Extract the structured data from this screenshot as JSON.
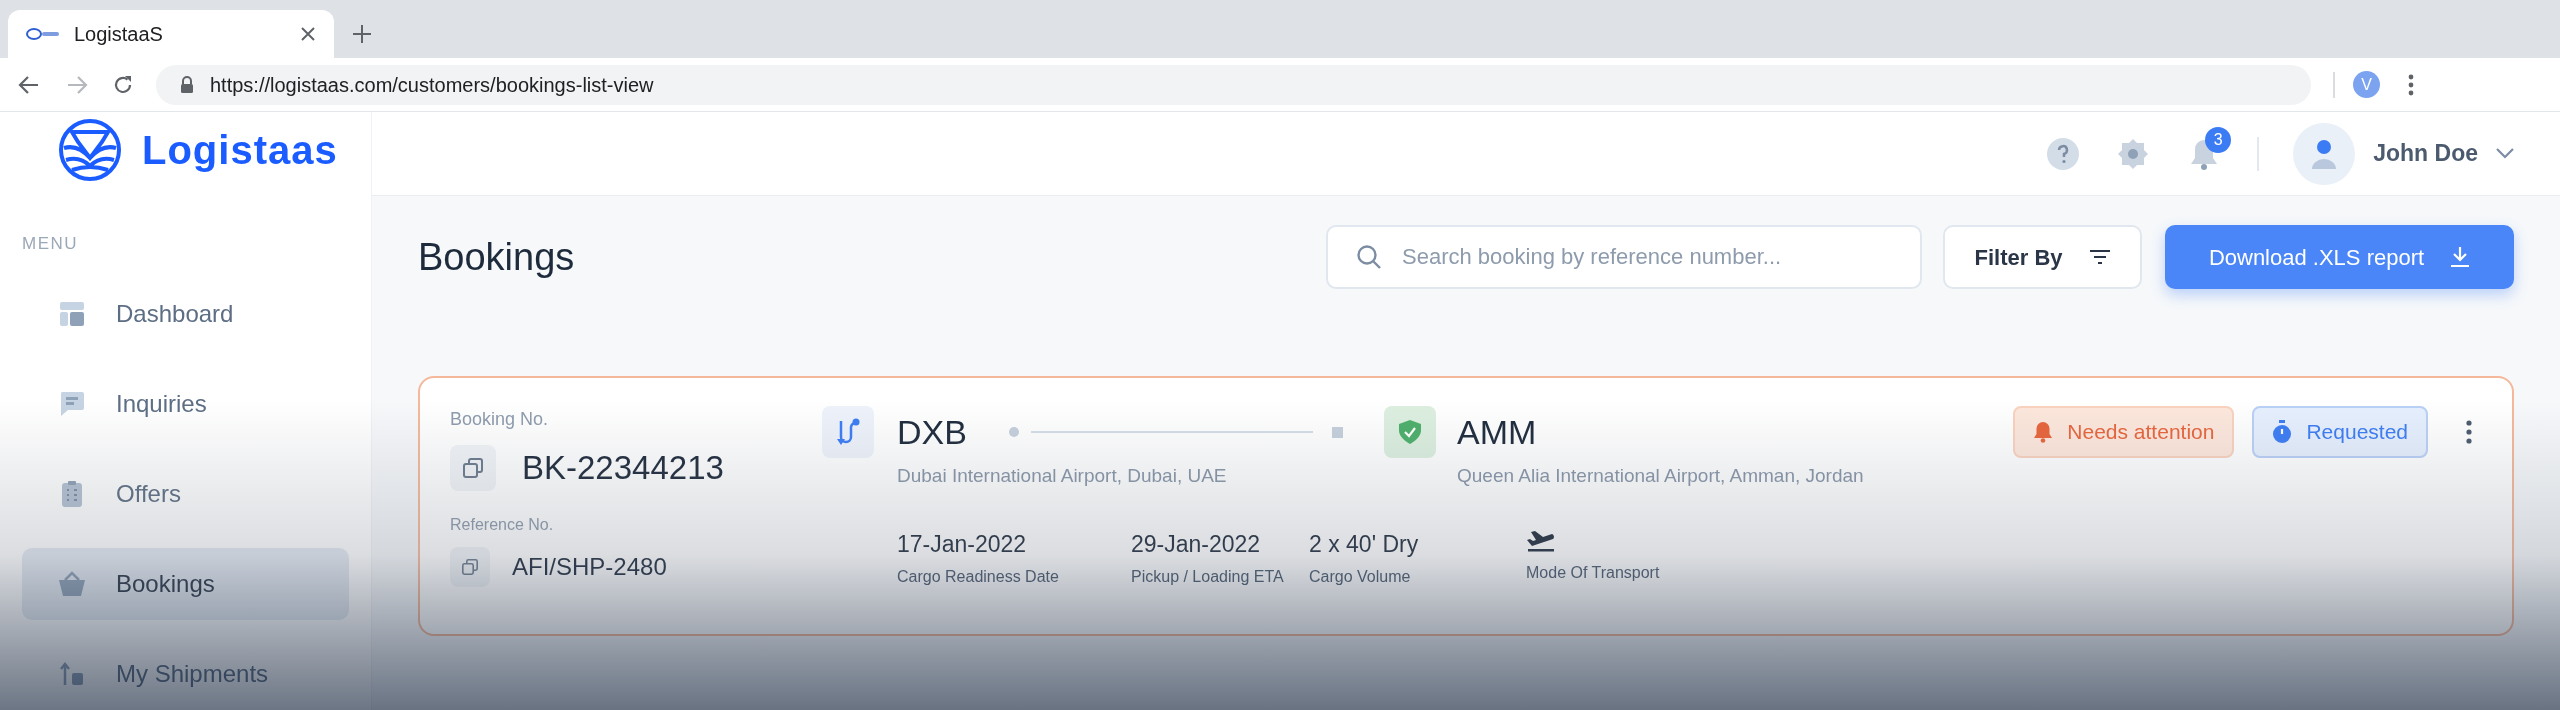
{
  "browser": {
    "tab_title": "LogistaaS",
    "url": "https://logistaas.com/customers/bookings-list-view",
    "profile_initial": "V"
  },
  "sidebar": {
    "logo_text": "Logistaas",
    "menu_label": "MENU",
    "items": [
      {
        "label": "Dashboard",
        "kind": "dashboard",
        "selected": false
      },
      {
        "label": "Inquiries",
        "kind": "inquiries",
        "selected": false
      },
      {
        "label": "Offers",
        "kind": "offers",
        "selected": false
      },
      {
        "label": "Bookings",
        "kind": "bookings",
        "selected": true
      },
      {
        "label": "My Shipments",
        "kind": "shipments",
        "selected": false
      }
    ]
  },
  "header": {
    "notification_count": "3",
    "user_name": "John Doe"
  },
  "page": {
    "title": "Bookings",
    "search": {
      "placeholder": "Search booking by reference number..."
    },
    "filter_button": "Filter By",
    "download_button": "Download .XLS report"
  },
  "bookings": [
    {
      "booking_label": "Booking No.",
      "booking_no": "BK-22344213",
      "reference_label": "Reference No.",
      "reference_no": "AFI/SHP-2480",
      "origin": {
        "code": "DXB",
        "name": "Dubai International Airport, Dubai, UAE"
      },
      "destination": {
        "code": "AMM",
        "name": "Queen Alia International Airport, Amman, Jordan"
      },
      "details": [
        {
          "kind": "text",
          "value": "17-Jan-2022",
          "label": "Cargo Readiness Date"
        },
        {
          "kind": "text",
          "value": "29-Jan-2022",
          "label": "Pickup / Loading ETA"
        },
        {
          "kind": "text",
          "value": "2 x 40' Dry",
          "label": "Cargo Volume"
        },
        {
          "kind": "air",
          "label": "Mode Of Transport"
        }
      ],
      "badges": [
        {
          "kind": "attention",
          "label": "Needs attention"
        },
        {
          "kind": "requested",
          "label": "Requested"
        }
      ]
    }
  ]
}
